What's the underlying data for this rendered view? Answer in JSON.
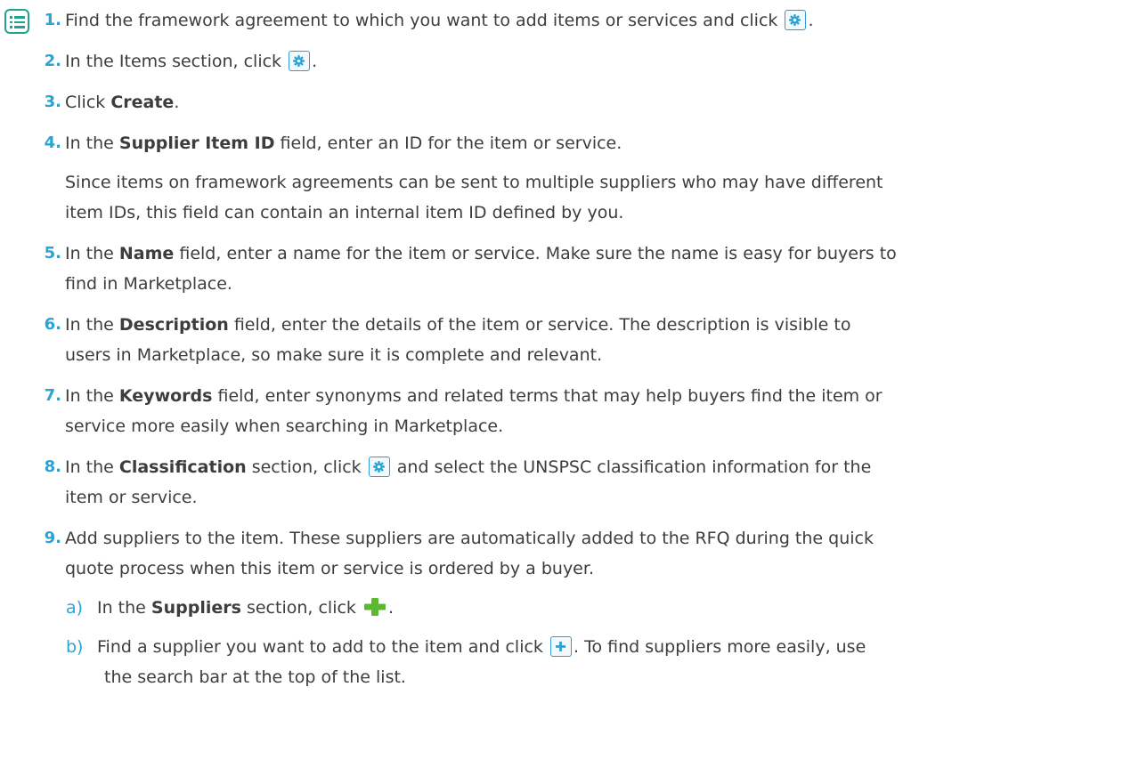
{
  "icons": {
    "list": "list-icon",
    "gear": "gear-icon",
    "add": "add-icon",
    "plus_green": "green-plus-icon",
    "accent": "#29a4d4",
    "icon_border": "#2d9cd9",
    "list_icon_color": "#1fa58f",
    "plus_color": "#5cb82e"
  },
  "steps": [
    {
      "number": "1.",
      "before": "Find the framework agreement to which you want to add items or services and click",
      "after": "."
    },
    {
      "number": "2.",
      "before": "In the Items section, click",
      "after": "."
    },
    {
      "number": "3.",
      "before": "Click ",
      "bold": "Create",
      "after": "."
    },
    {
      "number": "4.",
      "before": "In the ",
      "bold": "Supplier Item ID",
      "after": " field, enter an ID for the item or service.",
      "note_line1": "Since items on framework agreements can be sent to multiple suppliers who may have different",
      "note_line2": "item IDs, this field can contain an internal item ID defined by you."
    },
    {
      "number": "5.",
      "before": "In the ",
      "bold": "Name",
      "after_line1": " field, enter a name for the item or service. Make sure the name is easy for buyers to",
      "after_line2": "find in Marketplace."
    },
    {
      "number": "6.",
      "before": "In the ",
      "bold": "Description",
      "after_line1": " field, enter the details of the item or service. The description is visible to",
      "after_line2": "users in Marketplace, so make sure it is complete and relevant."
    },
    {
      "number": "7.",
      "before": "In the ",
      "bold": "Keywords",
      "after_line1": " field, enter synonyms and related terms that may help buyers find the item or",
      "after_line2": "service more easily when searching in Marketplace."
    },
    {
      "number": "8.",
      "before": "In the ",
      "bold": "Classification",
      "middle": " section, click",
      "after_line1": " and select the UNSPSC classification information for the",
      "after_line2": "item or service."
    },
    {
      "number": "9.",
      "line1": "Add suppliers to the item. These suppliers are automatically added to the RFQ during the quick",
      "line2": "quote process when this item or service is ordered by a buyer.",
      "substeps": [
        {
          "letter": "a)",
          "before": "In the ",
          "bold": "Suppliers",
          "after": " section, click",
          "end": "."
        },
        {
          "letter": "b)",
          "before": "Find a supplier you want to add to the item and click",
          "after_line1": ". To find suppliers more easily, use",
          "after_line2": "the search bar at the top of the list."
        }
      ]
    }
  ]
}
